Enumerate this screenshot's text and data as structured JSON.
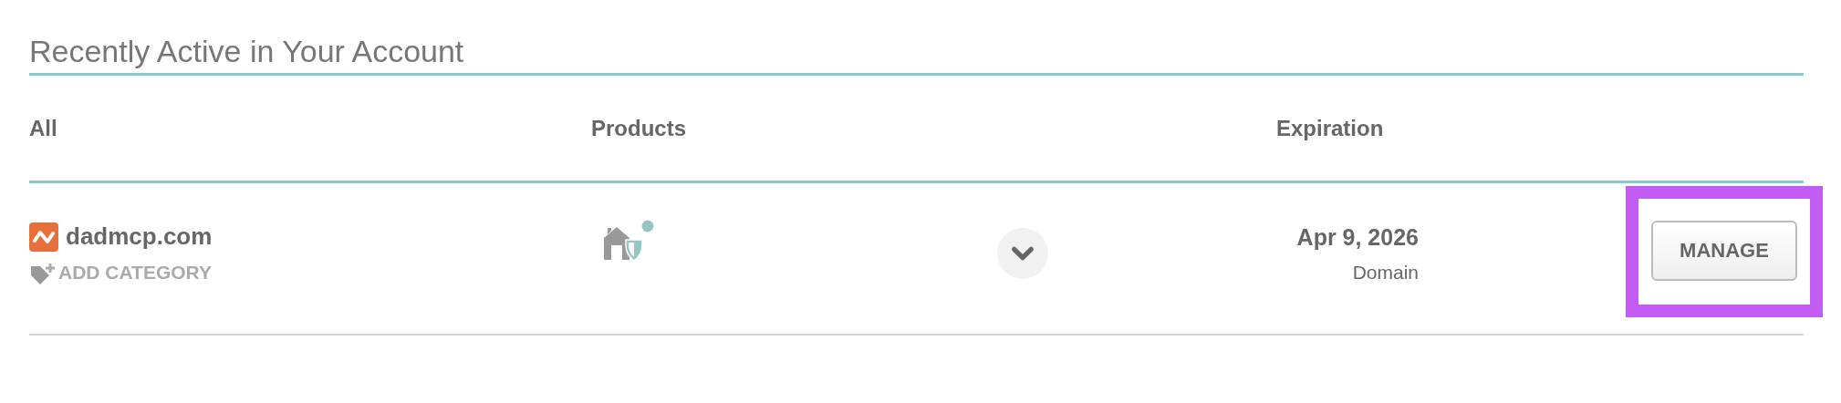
{
  "title": "Recently Active in Your Account",
  "columns": [
    "All",
    "Products",
    "Expiration"
  ],
  "rows": [
    {
      "name": "dadmcp.com",
      "add_category": "ADD CATEGORY",
      "expires": "Apr 9, 2026",
      "product_type": "Domain",
      "action": "MANAGE",
      "highlighted": true,
      "expanded": false
    }
  ]
}
